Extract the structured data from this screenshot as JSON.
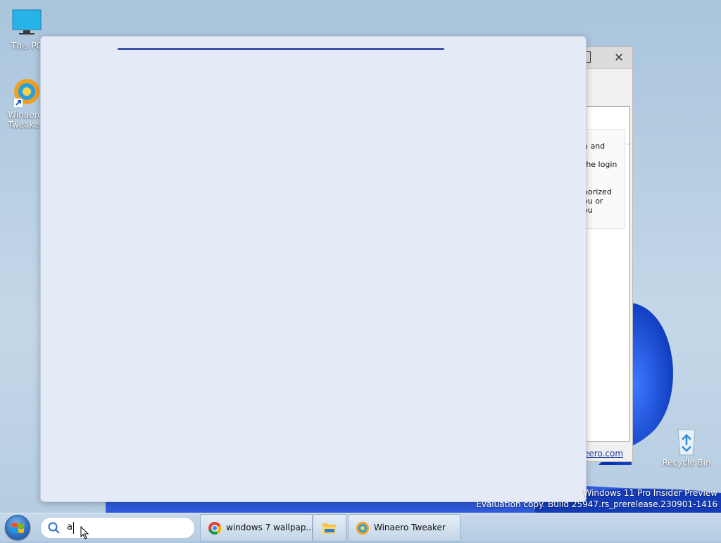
{
  "desktop": {
    "icons": [
      {
        "label": "This PC"
      },
      {
        "label_line1": "Winaero",
        "label_line2": "Tweaker"
      },
      {
        "label": "Recycle Bin"
      }
    ]
  },
  "background_window": {
    "close_glyph": "✕",
    "text_lines": [
      "n and",
      "the login",
      "horized",
      "ou or",
      "ou"
    ],
    "link": "eero.com"
  },
  "search_flyout": {
    "progress_visible": true
  },
  "watermark": {
    "line1": "Windows 11 Pro Insider Preview",
    "line2": "Evaluation copy. Build 25947.rs_prerelease.230901-1416"
  },
  "taskbar": {
    "search_value": "a",
    "buttons": [
      {
        "label": "windows 7 wallpap...",
        "icon": "chrome-icon"
      },
      {
        "label": "",
        "icon": "file-explorer-icon"
      },
      {
        "label": "Winaero Tweaker",
        "icon": "winaero-tweaker-icon"
      }
    ]
  },
  "colors": {
    "accent": "#3f51a8",
    "flyout_bg": "#e4ebf6",
    "wallpaper_blue": "#0a3fc4"
  }
}
